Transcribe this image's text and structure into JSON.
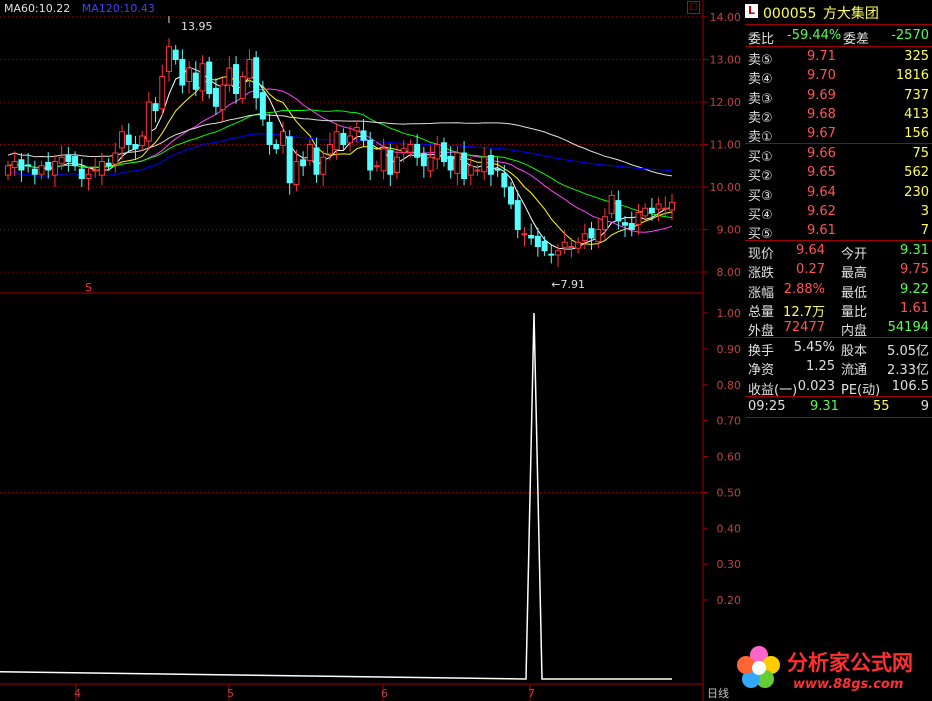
{
  "chart_area": {
    "ma_legend": [
      {
        "text": "MA60:10.22",
        "color": "#e0e0e0"
      },
      {
        "text": "MA120:10.43",
        "color": "#4040ff"
      }
    ],
    "price_axis": [
      "14.00",
      "13.00",
      "12.00",
      "11.00",
      "10.00",
      "9.00",
      "8.00"
    ],
    "indicator_axis": [
      "1.00",
      "0.90",
      "0.80",
      "0.70",
      "0.60",
      "0.50",
      "0.40",
      "0.30",
      "0.20"
    ],
    "x_ticks": [
      "4",
      "5",
      "6",
      "7"
    ],
    "high_marker": "13.95",
    "low_marker": "7.91",
    "signal_marker": "S",
    "period_label": "日线"
  },
  "colors": {
    "up": "#ff3232",
    "down": "#54ffff",
    "ma5": "#ffffff",
    "ma10": "#ffff00",
    "ma20": "#ff40ff",
    "ma30": "#00ff00",
    "ma60": "#e0e0e0",
    "ma120": "#0000ff",
    "grid": "#a00000",
    "indicator_line": "#ffffff"
  },
  "chart_data": {
    "type": "candlestick",
    "note_series": [
      "MA60",
      "MA120"
    ],
    "ylim": [
      7.6,
      14.4
    ],
    "indicator_ylim": [
      0,
      1.0
    ],
    "indicator_peak": 1.0,
    "period": "日线"
  },
  "panel": {
    "code": "000055",
    "name": "方大集团",
    "weibi_label": "委比",
    "weibi_value": "-59.44%",
    "weicha_label": "委差",
    "weicha_value": "-2570",
    "sells": [
      {
        "label": "卖⑤",
        "price": "9.71",
        "vol": "325"
      },
      {
        "label": "卖④",
        "price": "9.70",
        "vol": "1816"
      },
      {
        "label": "卖③",
        "price": "9.69",
        "vol": "737"
      },
      {
        "label": "卖②",
        "price": "9.68",
        "vol": "413"
      },
      {
        "label": "卖①",
        "price": "9.67",
        "vol": "156"
      }
    ],
    "buys": [
      {
        "label": "买①",
        "price": "9.66",
        "vol": "75"
      },
      {
        "label": "买②",
        "price": "9.65",
        "vol": "562"
      },
      {
        "label": "买③",
        "price": "9.64",
        "vol": "230"
      },
      {
        "label": "买④",
        "price": "9.62",
        "vol": "3"
      },
      {
        "label": "买⑤",
        "price": "9.61",
        "vol": "7"
      }
    ],
    "stats": [
      {
        "l1": "现价",
        "v1": "9.64",
        "c1": "red",
        "l2": "今开",
        "v2": "9.31",
        "c2": "green"
      },
      {
        "l1": "涨跌",
        "v1": "0.27",
        "c1": "red",
        "l2": "最高",
        "v2": "9.75",
        "c2": "red"
      },
      {
        "l1": "涨幅",
        "v1": "2.88%",
        "c1": "red",
        "l2": "最低",
        "v2": "9.22",
        "c2": "green"
      },
      {
        "l1": "总量",
        "v1": "12.7万",
        "c1": "yellow",
        "l2": "量比",
        "v2": "1.61",
        "c2": "red"
      },
      {
        "l1": "外盘",
        "v1": "72477",
        "c1": "red",
        "l2": "内盘",
        "v2": "54194",
        "c2": "green"
      }
    ],
    "stats2": [
      {
        "l1": "换手",
        "v1": "5.45%",
        "l2": "股本",
        "v2": "5.05亿"
      },
      {
        "l1": "净资",
        "v1": "1.25",
        "l2": "流通",
        "v2": "2.33亿"
      },
      {
        "l1": "收益(一)",
        "v1": "0.023",
        "l2": "PE(动)",
        "v2": "106.5"
      }
    ],
    "tick": {
      "time": "09:25",
      "price": "9.31",
      "vol": "55",
      "n": "9"
    }
  },
  "brand": {
    "name": "分析家公式网",
    "url": "www.88gs.com"
  }
}
